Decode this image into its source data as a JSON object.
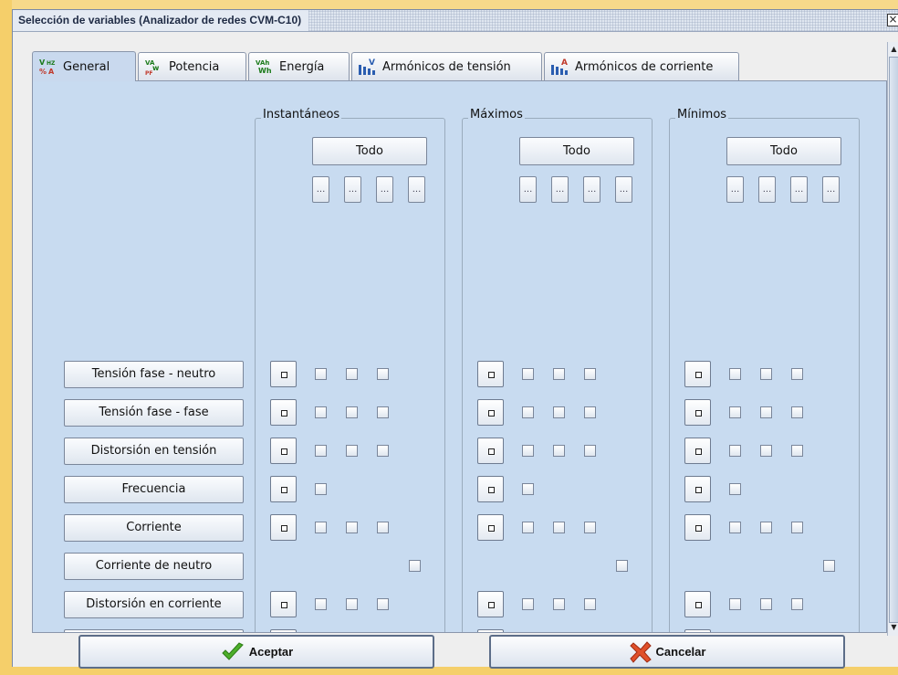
{
  "window": {
    "title": "Selección de variables (Analizador de redes CVM-C10)"
  },
  "tabs": [
    {
      "label": "General",
      "icon": "general-icon",
      "active": true
    },
    {
      "label": "Potencia",
      "icon": "power-icon"
    },
    {
      "label": "Energía",
      "icon": "energy-icon"
    },
    {
      "label": "Armónicos de tensión",
      "icon": "voltage-harmonics-icon"
    },
    {
      "label": "Armónicos de corriente",
      "icon": "current-harmonics-icon"
    }
  ],
  "groups": [
    {
      "title": "Instantáneos",
      "all_label": "Todo",
      "phase_label": "..."
    },
    {
      "title": "Máximos",
      "all_label": "Todo",
      "phase_label": "..."
    },
    {
      "title": "Mínimos",
      "all_label": "Todo",
      "phase_label": "..."
    }
  ],
  "rows": [
    {
      "label": "Tensión fase - neutro"
    },
    {
      "label": "Tensión fase - fase"
    },
    {
      "label": "Distorsión en tensión"
    },
    {
      "label": "Frecuencia"
    },
    {
      "label": "Corriente"
    },
    {
      "label": "Corriente de neutro"
    },
    {
      "label": "Distorsión en corriente"
    },
    {
      "label": ""
    }
  ],
  "actions": {
    "accept_label": "Aceptar",
    "cancel_label": "Cancelar"
  },
  "colors": {
    "panel": "#c8dbf0",
    "desktop": "#f7d98a",
    "accept_check": "#4caf2a",
    "cancel_x": "#e0502a"
  }
}
